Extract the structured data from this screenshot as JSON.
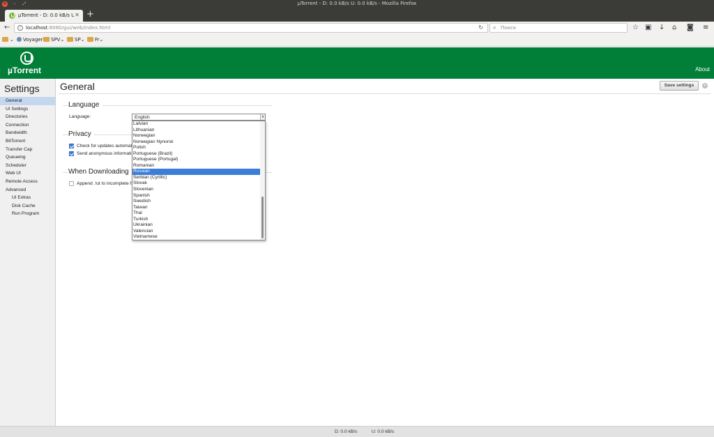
{
  "browser": {
    "window_title": "µTorrent - D: 0.0 kB/s U: 0.0 kB/s - Mozilla Firefox",
    "tab_title": "µTorrent - D: 0.0 kB/s U: ...",
    "url_host": "localhost",
    "url_rest": ":8080/gui/web/index.html",
    "search_placeholder": "Поиск",
    "bookmarks": [
      {
        "label": ""
      },
      {
        "label": "Voyager"
      },
      {
        "label": "SPV"
      },
      {
        "label": "SP"
      },
      {
        "label": "Fr"
      }
    ]
  },
  "app": {
    "logo": "µTorrent",
    "about": "About"
  },
  "sidebar": {
    "title": "Settings",
    "items": [
      {
        "label": "General",
        "active": true
      },
      {
        "label": "UI Settings"
      },
      {
        "label": "Directories"
      },
      {
        "label": "Connection"
      },
      {
        "label": "Bandwidth"
      },
      {
        "label": "BitTorrent"
      },
      {
        "label": "Transfer Cap"
      },
      {
        "label": "Queueing"
      },
      {
        "label": "Scheduler"
      },
      {
        "label": "Web UI"
      },
      {
        "label": "Remote Access"
      },
      {
        "label": "Advanced"
      },
      {
        "label": "UI Extras",
        "sub": true
      },
      {
        "label": "Disk Cache",
        "sub": true
      },
      {
        "label": "Run Program",
        "sub": true
      }
    ]
  },
  "main": {
    "title": "General",
    "save_label": "Save settings",
    "language": {
      "heading": "Language",
      "label": "Language:",
      "value": "English",
      "options": [
        "Latvian",
        "Lithuanian",
        "Norwegian",
        "Norwegian Nynorsk",
        "Polish",
        "Portuguese (Brazil)",
        "Portuguese (Portugal)",
        "Romanian",
        "Russian",
        "Serbian (Cyrillic)",
        "Slovak",
        "Slovenian",
        "Spanish",
        "Swedish",
        "Taiwan",
        "Thai",
        "Turkish",
        "Ukrainian",
        "Valencian",
        "Vietnamese"
      ],
      "highlighted": "Russian"
    },
    "privacy": {
      "heading": "Privacy",
      "check_updates": "Check for updates automati",
      "send_anonymous": "Send anonymous informati"
    },
    "downloading": {
      "heading": "When Downloading",
      "append_ut": "Append .!ut to incomplete fi"
    }
  },
  "status": {
    "down": "D: 0.0 kB/s",
    "up": "U: 0.0 kB/s"
  }
}
